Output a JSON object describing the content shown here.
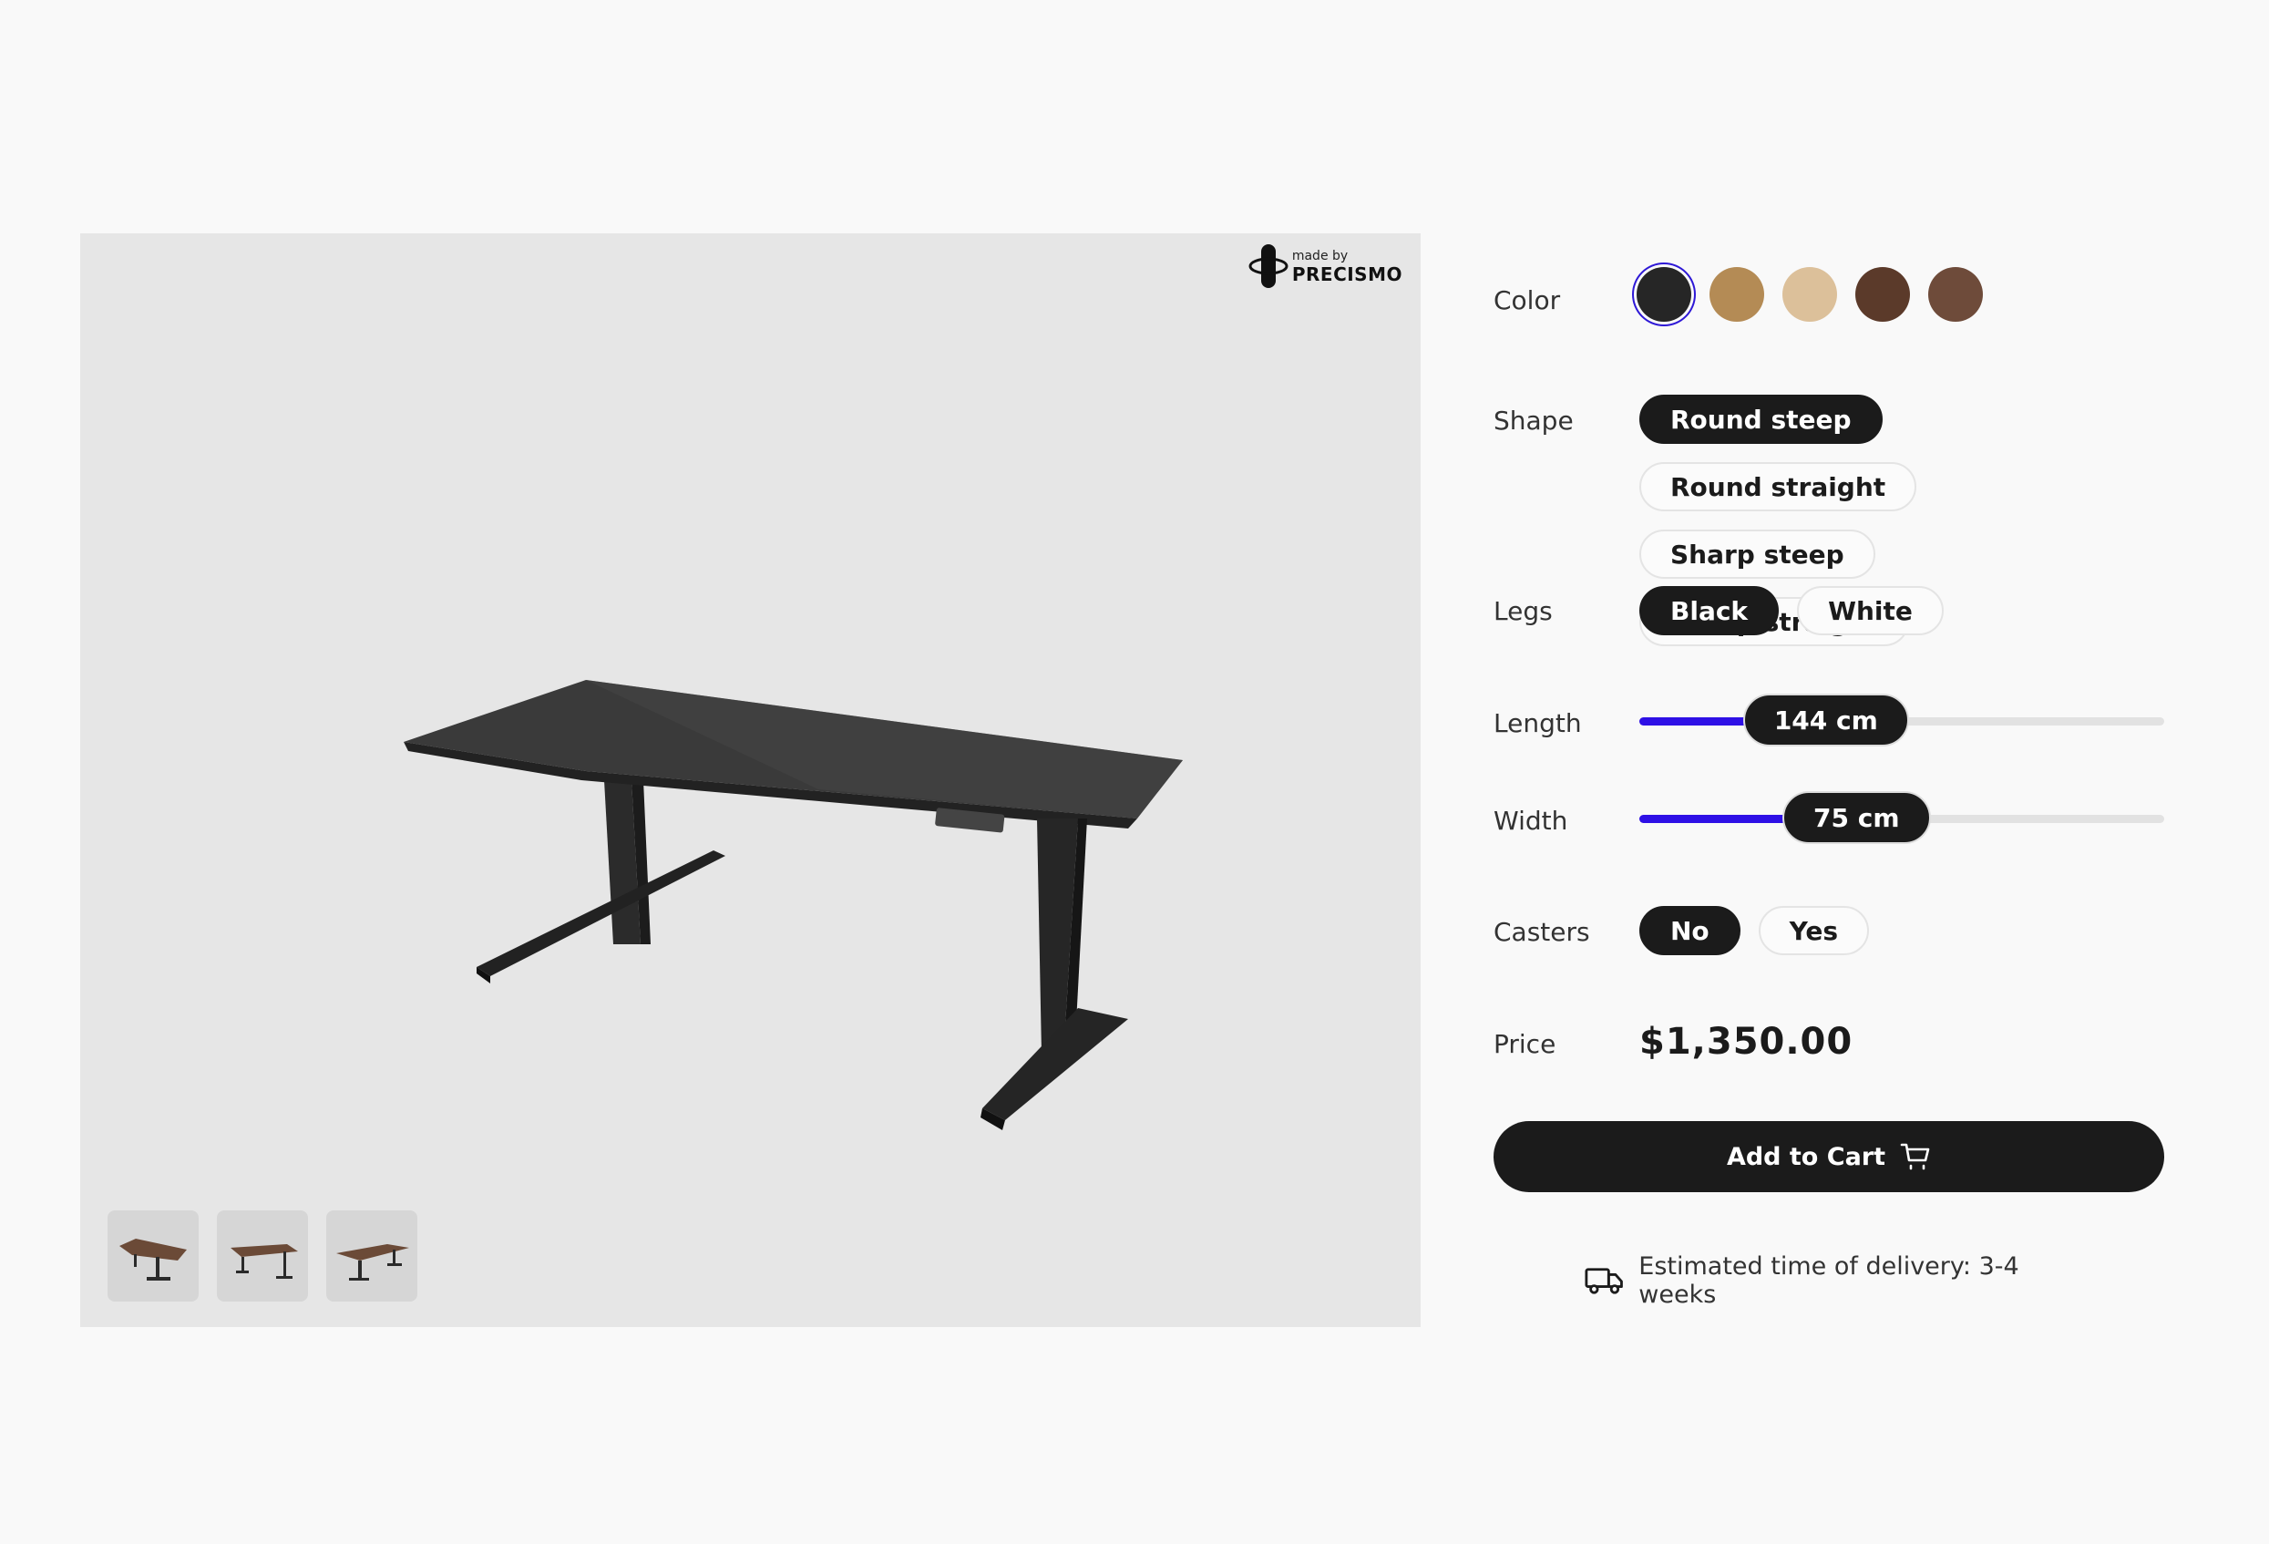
{
  "brand": {
    "prefix": "made by",
    "name": "PRECISMO"
  },
  "thumbnails": [
    {
      "icon": "desk-thumbnail-icon",
      "label": "view 1"
    },
    {
      "icon": "desk-thumbnail-icon",
      "label": "view 2"
    },
    {
      "icon": "desk-thumbnail-icon",
      "label": "view 3"
    }
  ],
  "options": {
    "color": {
      "label": "Color",
      "swatches": [
        {
          "name": "black",
          "color": "#262626",
          "selected": true
        },
        {
          "name": "oak",
          "color": "#b48b55"
        },
        {
          "name": "light-oak",
          "color": "#dcc09a"
        },
        {
          "name": "walnut",
          "color": "#5b3a2a"
        },
        {
          "name": "dark-walnut",
          "color": "#6e4b3a"
        }
      ],
      "selected_ring_color": "#2e18d6"
    },
    "shape": {
      "label": "Shape",
      "items": [
        "Round steep",
        "Round straight",
        "Sharp steep",
        "Sharp straight"
      ],
      "selected": "Round steep"
    },
    "legs": {
      "label": "Legs",
      "items": [
        "Black",
        "White"
      ],
      "selected": "Black"
    },
    "length": {
      "label": "Length",
      "value_text": "144 cm",
      "fraction": 0.215
    },
    "width": {
      "label": "Width",
      "value_text": "75 cm",
      "fraction": 0.29
    },
    "casters": {
      "label": "Casters",
      "items": [
        "No",
        "Yes"
      ],
      "selected": "No"
    },
    "price": {
      "label": "Price",
      "value": "$1,350.00"
    }
  },
  "cart": {
    "label": "Add to Cart",
    "icon": "cart-icon"
  },
  "delivery": {
    "icon": "truck-icon",
    "text": "Estimated time of delivery: 3-4 weeks"
  },
  "accent_color": "#2e10e6"
}
